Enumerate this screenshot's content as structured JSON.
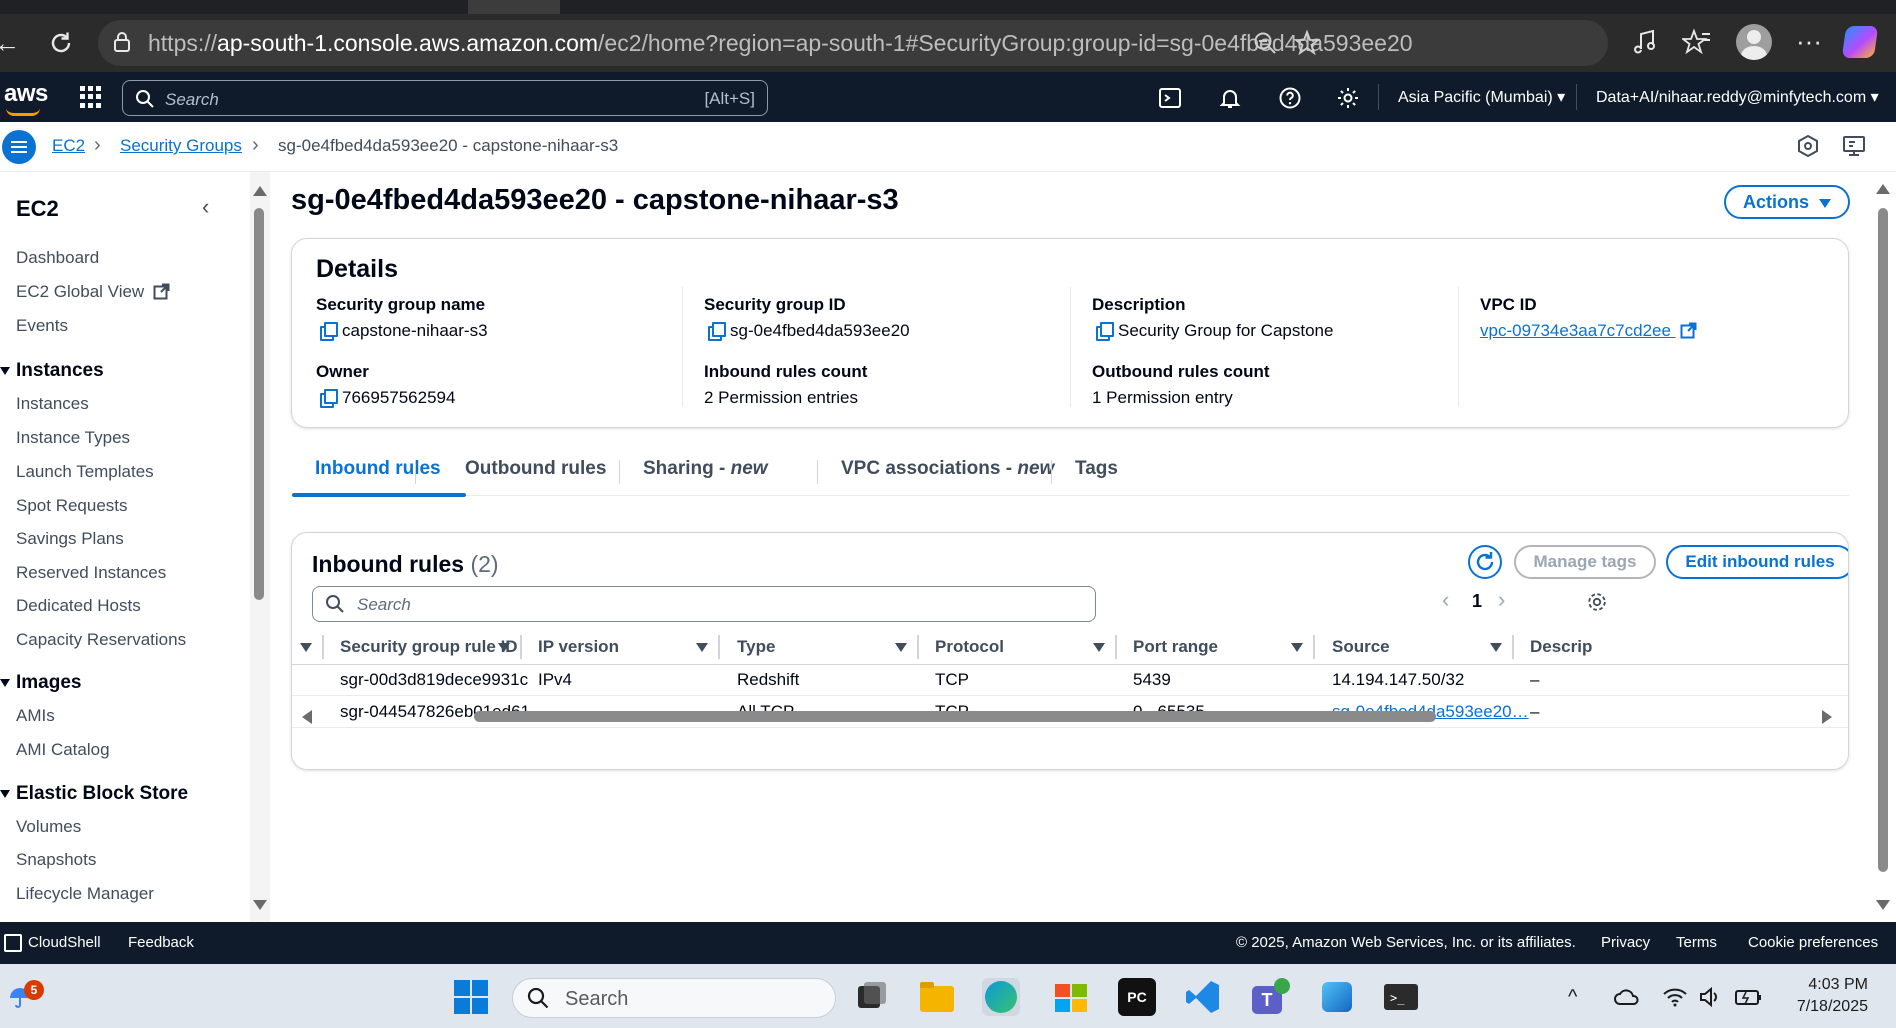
{
  "browser": {
    "url_prefix": "https://",
    "url_domain": "ap-south-1.console.aws.amazon.com",
    "url_path": "/ec2/home?region=ap-south-1#SecurityGroup:group-id=sg-0e4fbed4da593ee20"
  },
  "aws_nav": {
    "logo": "aws",
    "search_placeholder": "Search",
    "search_shortcut": "[Alt+S]",
    "region": "Asia Pacific (Mumbai)",
    "account": "Data+AI/nihaar.reddy@minfytech.com"
  },
  "breadcrumb": {
    "items": [
      "EC2",
      "Security Groups"
    ],
    "current": "sg-0e4fbed4da593ee20 - capstone-nihaar-s3"
  },
  "sidebar": {
    "title": "EC2",
    "top_items": [
      "Dashboard",
      "EC2 Global View",
      "Events"
    ],
    "sections": [
      {
        "title": "Instances",
        "items": [
          "Instances",
          "Instance Types",
          "Launch Templates",
          "Spot Requests",
          "Savings Plans",
          "Reserved Instances",
          "Dedicated Hosts",
          "Capacity Reservations"
        ]
      },
      {
        "title": "Images",
        "items": [
          "AMIs",
          "AMI Catalog"
        ]
      },
      {
        "title": "Elastic Block Store",
        "items": [
          "Volumes",
          "Snapshots",
          "Lifecycle Manager"
        ]
      }
    ]
  },
  "page": {
    "title": "sg-0e4fbed4da593ee20 - capstone-nihaar-s3",
    "actions_label": "Actions"
  },
  "details": {
    "heading": "Details",
    "fields": [
      {
        "label": "Security group name",
        "value": "capstone-nihaar-s3"
      },
      {
        "label": "Security group ID",
        "value": "sg-0e4fbed4da593ee20"
      },
      {
        "label": "Description",
        "value": "Security Group for Capstone"
      },
      {
        "label": "VPC ID",
        "value": "vpc-09734e3aa7c7cd2ee"
      },
      {
        "label": "Owner",
        "value": "766957562594"
      },
      {
        "label": "Inbound rules count",
        "value": "2 Permission entries"
      },
      {
        "label": "Outbound rules count",
        "value": "1 Permission entry"
      }
    ]
  },
  "tabs": [
    {
      "label": "Inbound rules",
      "suffix": ""
    },
    {
      "label": "Outbound rules",
      "suffix": ""
    },
    {
      "label": "Sharing - ",
      "suffix": "new"
    },
    {
      "label": "VPC associations - ",
      "suffix": "new"
    },
    {
      "label": "Tags",
      "suffix": ""
    }
  ],
  "inbound": {
    "heading": "Inbound rules",
    "count": "(2)",
    "manage_tags": "Manage tags",
    "edit_rules": "Edit inbound rules",
    "search_placeholder": "Search",
    "page": "1",
    "columns": [
      "Security group rule ID",
      "IP version",
      "Type",
      "Protocol",
      "Port range",
      "Source",
      "Descrip"
    ],
    "rows": [
      [
        "sgr-00d3d819dece9931c",
        "IPv4",
        "Redshift",
        "TCP",
        "5439",
        "14.194.147.50/32",
        "–"
      ],
      [
        "sgr-044547826eb01ed61",
        "–",
        "All TCP",
        "TCP",
        "0 - 65535",
        "sg-0e4fbed4da593ee20…",
        "–"
      ]
    ]
  },
  "footer": {
    "cloudshell": "CloudShell",
    "feedback": "Feedback",
    "copyright": "© 2025, Amazon Web Services, Inc. or its affiliates.",
    "privacy": "Privacy",
    "terms": "Terms",
    "cookies": "Cookie preferences"
  },
  "taskbar": {
    "badge": "5",
    "search_placeholder": "Search",
    "time": "4:03 PM",
    "date": "7/18/2025",
    "pycharm_label": "PC"
  }
}
